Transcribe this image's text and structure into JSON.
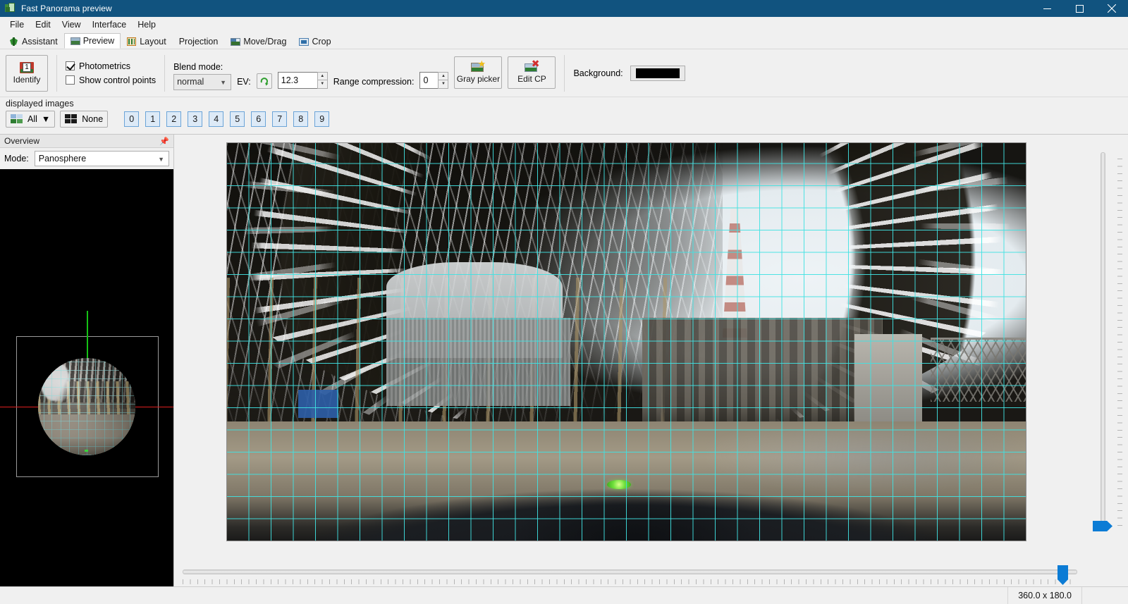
{
  "window": {
    "title": "Fast Panorama preview",
    "icon": "panorama-app-icon",
    "minimize_label": "Minimize",
    "maximize_label": "Restore",
    "close_label": "Close"
  },
  "menu": {
    "items": [
      {
        "label": "File"
      },
      {
        "label": "Edit"
      },
      {
        "label": "View"
      },
      {
        "label": "Interface"
      },
      {
        "label": "Help"
      }
    ]
  },
  "tabs": {
    "items": [
      {
        "label": "Assistant",
        "icon": "assistant-icon",
        "active": false
      },
      {
        "label": "Preview",
        "icon": "preview-icon",
        "active": true
      },
      {
        "label": "Layout",
        "icon": "layout-grid-icon",
        "active": false
      },
      {
        "label": "Projection",
        "icon": "",
        "active": false
      },
      {
        "label": "Move/Drag",
        "icon": "move-drag-icon",
        "active": false
      },
      {
        "label": "Crop",
        "icon": "crop-icon",
        "active": false
      }
    ]
  },
  "toolbar": {
    "identify_label": "Identify",
    "identify_icon": "identify-number-icon",
    "identify_badge": "1",
    "photometrics_label": "Photometrics",
    "photometrics_checked": true,
    "show_control_points_label": "Show control points",
    "show_control_points_checked": false,
    "blend_mode_label": "Blend mode:",
    "blend_mode_value": "normal",
    "blend_mode_options": [
      "normal"
    ],
    "ev_label": "EV:",
    "ev_reset_icon": "reset-arrow-icon",
    "ev_value": "12.3",
    "range_compression_label": "Range compression:",
    "range_compression_value": "0",
    "gray_picker_label": "Gray picker",
    "gray_picker_icon": "gray-picker-icon",
    "edit_cp_label": "Edit CP",
    "edit_cp_icon": "edit-control-points-icon",
    "background_label": "Background:",
    "background_color": "#000000"
  },
  "displayed_images": {
    "caption": "displayed images",
    "all_label": "All",
    "all_caret": "▼",
    "none_label": "None",
    "numbers": [
      "0",
      "1",
      "2",
      "3",
      "4",
      "5",
      "6",
      "7",
      "8",
      "9"
    ]
  },
  "overview": {
    "panel_title": "Overview",
    "pin_icon": "pin-icon",
    "mode_label": "Mode:",
    "mode_value": "Panosphere",
    "mode_options": [
      "Panosphere"
    ]
  },
  "preview": {
    "projection_grid_color": "#40e2e2",
    "canvas_background": "#000000",
    "scene_description": "equirectangular industrial hall panorama with grid overlay"
  },
  "sliders": {
    "horizontal_name": "horizontal-field-of-view-slider",
    "vertical_name": "vertical-field-of-view-slider"
  },
  "statusbar": {
    "fov": "360.0 x 180.0"
  }
}
